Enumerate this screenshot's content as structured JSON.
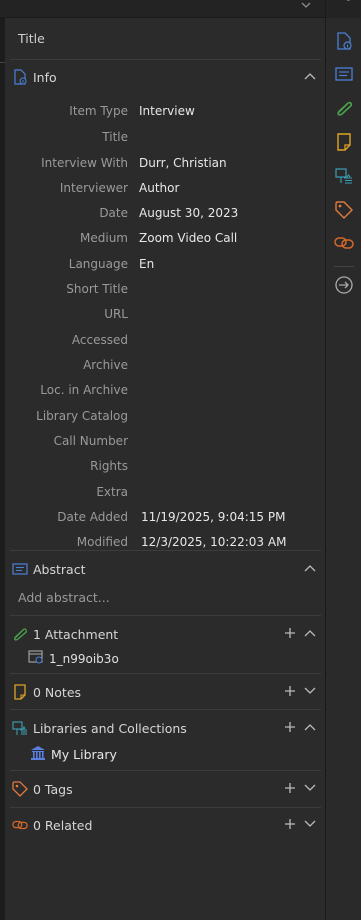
{
  "pane_title": "Title",
  "sections": {
    "info": {
      "label": "Info"
    },
    "abstract": {
      "label": "Abstract",
      "placeholder": "Add abstract..."
    },
    "attachments": {
      "label": "1 Attachment",
      "item": "1_n99oib3o"
    },
    "notes": {
      "label": "0 Notes"
    },
    "libraries": {
      "label": "Libraries and Collections",
      "item": "My Library"
    },
    "tags": {
      "label": "0 Tags"
    },
    "related": {
      "label": "0 Related"
    }
  },
  "fields": [
    {
      "label": "Item Type",
      "value": "Interview"
    },
    {
      "label": "Title",
      "value": ""
    },
    {
      "label": "Interview With",
      "value": "Durr, Christian"
    },
    {
      "label": "Interviewer",
      "value": "Author"
    },
    {
      "label": "Date",
      "value": "August 30, 2023"
    },
    {
      "label": "Medium",
      "value": "Zoom Video Call"
    },
    {
      "label": "Language",
      "value": "En"
    },
    {
      "label": "Short Title",
      "value": ""
    },
    {
      "label": "URL",
      "value": ""
    },
    {
      "label": "Accessed",
      "value": ""
    },
    {
      "label": "Archive",
      "value": ""
    },
    {
      "label": "Loc. in Archive",
      "value": ""
    },
    {
      "label": "Library Catalog",
      "value": ""
    },
    {
      "label": "Call Number",
      "value": ""
    },
    {
      "label": "Rights",
      "value": ""
    },
    {
      "label": "Extra",
      "value": ""
    },
    {
      "label": "Date Added",
      "value": "11/19/2025, 9:04:15 PM"
    },
    {
      "label": "Modified",
      "value": "12/3/2025, 10:22:03 AM"
    }
  ],
  "colors": {
    "info_icon": "#4a7fd6",
    "abstract_icon": "#4a7fd6",
    "attachment_icon": "#4ca24c",
    "notes_icon": "#e0a323",
    "libraries_icon": "#3aa0b5",
    "tags_icon": "#e07b3c",
    "related_icon": "#d4682a"
  }
}
